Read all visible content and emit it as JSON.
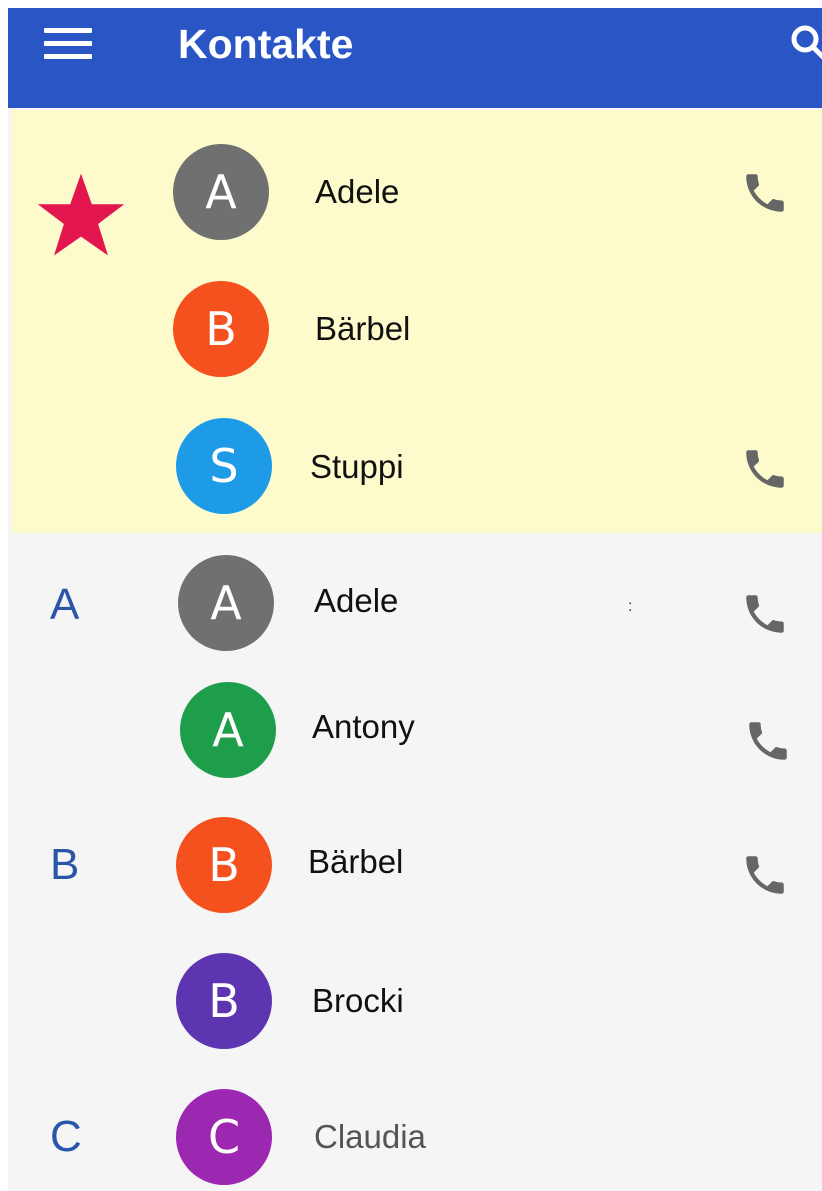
{
  "app": {
    "title": "Kontakte"
  },
  "icons": {
    "menu": "menu-icon",
    "search": "search-icon",
    "favorite": "star-icon",
    "call": "phone-icon"
  },
  "colors": {
    "appbar": "#2a55c4",
    "favorites_bg": "#fdfbcc",
    "list_bg": "#f5f5f5",
    "star": "#e3154f",
    "section_letter": "#2a55a8",
    "phone_icon": "#666666"
  },
  "favorites": [
    {
      "initial": "A",
      "name": "Adele",
      "avatar_color": "#707070",
      "has_call": true
    },
    {
      "initial": "B",
      "name": "Bärbel",
      "avatar_color": "#f4511e",
      "has_call": false
    },
    {
      "initial": "S",
      "name": "Stuppi",
      "avatar_color": "#1e9be6",
      "has_call": true
    }
  ],
  "sections": [
    {
      "letter": "A",
      "contacts": [
        {
          "initial": "A",
          "name": "Adele",
          "avatar_color": "#707070",
          "has_call": true
        },
        {
          "initial": "A",
          "name": "Antony",
          "avatar_color": "#1e9e4a",
          "has_call": true
        }
      ]
    },
    {
      "letter": "B",
      "contacts": [
        {
          "initial": "B",
          "name": "Bärbel",
          "avatar_color": "#f4511e",
          "has_call": true
        },
        {
          "initial": "B",
          "name": "Brocki",
          "avatar_color": "#5e35b1",
          "has_call": false
        }
      ]
    },
    {
      "letter": "C",
      "contacts": [
        {
          "initial": "C",
          "name": "Claudia",
          "avatar_color": "#9c27b0",
          "has_call": false
        }
      ]
    }
  ]
}
